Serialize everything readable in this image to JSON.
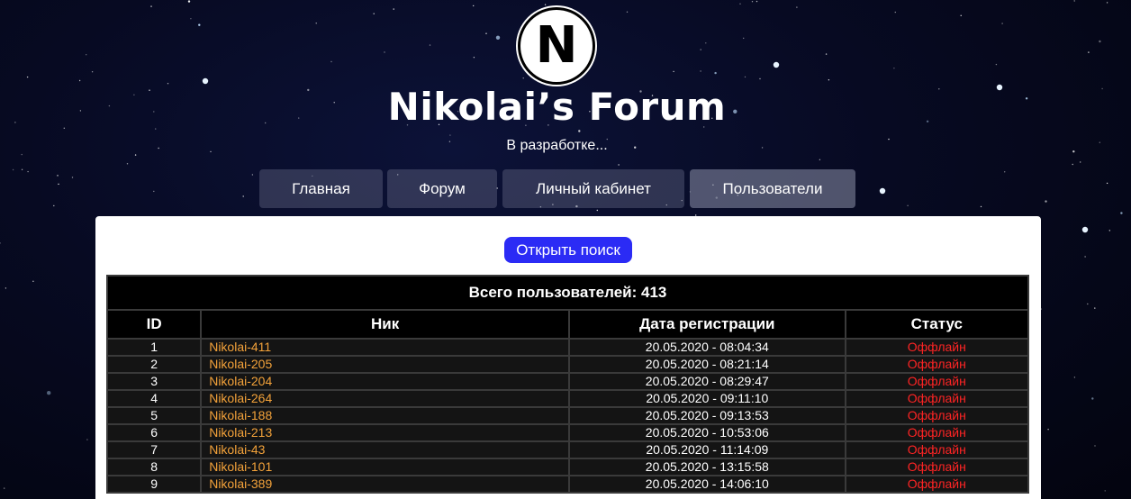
{
  "header": {
    "logo_letter": "N",
    "title": "Nikolai’s Forum",
    "subtitle": "В разработке..."
  },
  "nav": {
    "items": [
      {
        "label": "Главная"
      },
      {
        "label": "Форум"
      },
      {
        "label": "Личный кабинет"
      },
      {
        "label": "Пользователи",
        "active": true
      }
    ]
  },
  "search": {
    "label": "Открыть поиск"
  },
  "users_table": {
    "caption": "Всего пользователей: 413",
    "columns": [
      "ID",
      "Ник",
      "Дата регистрации",
      "Статус"
    ],
    "rows": [
      {
        "id": "1",
        "nick": "Nikolai-411",
        "date": "20.05.2020 - 08:04:34",
        "status": "Оффлайн"
      },
      {
        "id": "2",
        "nick": "Nikolai-205",
        "date": "20.05.2020 - 08:21:14",
        "status": "Оффлайн"
      },
      {
        "id": "3",
        "nick": "Nikolai-204",
        "date": "20.05.2020 - 08:29:47",
        "status": "Оффлайн"
      },
      {
        "id": "4",
        "nick": "Nikolai-264",
        "date": "20.05.2020 - 09:11:10",
        "status": "Оффлайн"
      },
      {
        "id": "5",
        "nick": "Nikolai-188",
        "date": "20.05.2020 - 09:13:53",
        "status": "Оффлайн"
      },
      {
        "id": "6",
        "nick": "Nikolai-213",
        "date": "20.05.2020 - 10:53:06",
        "status": "Оффлайн"
      },
      {
        "id": "7",
        "nick": "Nikolai-43",
        "date": "20.05.2020 - 11:14:09",
        "status": "Оффлайн"
      },
      {
        "id": "8",
        "nick": "Nikolai-101",
        "date": "20.05.2020 - 13:15:58",
        "status": "Оффлайн"
      },
      {
        "id": "9",
        "nick": "Nikolai-389",
        "date": "20.05.2020 - 14:06:10",
        "status": "Оффлайн"
      }
    ]
  },
  "colors": {
    "accent_button": "#2b2bf5",
    "nick": "#f3a23a",
    "status_offline": "#ff2424",
    "background": "#070a22"
  }
}
